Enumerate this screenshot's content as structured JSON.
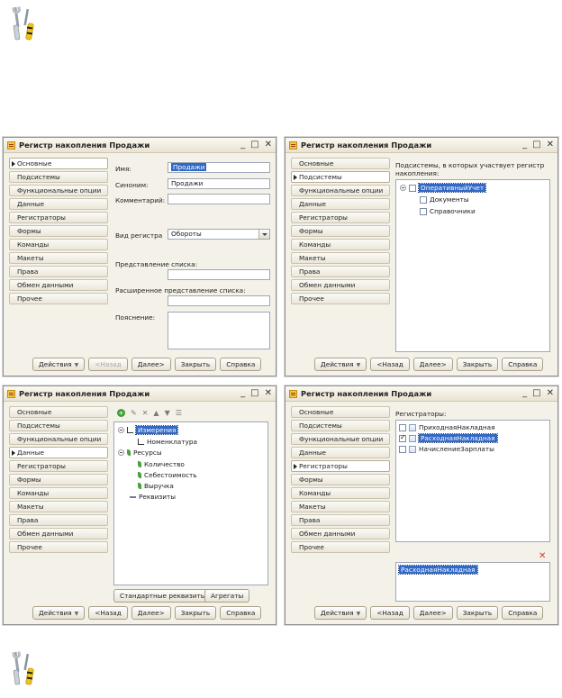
{
  "icons": {
    "top": "tools-icon",
    "bottom": "tools-icon"
  },
  "window_title": "Регистр накопления Продажи",
  "window_controls": [
    "_",
    "□",
    "✕"
  ],
  "nav_items": [
    "Основные",
    "Подсистемы",
    "Функциональные опции",
    "Данные",
    "Регистраторы",
    "Формы",
    "Команды",
    "Макеты",
    "Права",
    "Обмен данными",
    "Прочее"
  ],
  "buttons": {
    "actions": "Действия",
    "back": "<Назад",
    "next": "Далее>",
    "close": "Закрыть",
    "help": "Справка"
  },
  "win1": {
    "active_index": 0,
    "labels": {
      "name": "Имя:",
      "synonym": "Синоним:",
      "comment": "Комментарий:",
      "register_kind": "Вид регистра",
      "list_presentation": "Представление списка:",
      "ext_list_presentation": "Расширенное представление списка:",
      "explanation": "Пояснение:"
    },
    "values": {
      "name": "Продажи",
      "synonym": "Продажи",
      "comment": "",
      "register_kind": "Обороты",
      "list_presentation": "",
      "ext_list_presentation": "",
      "explanation": ""
    }
  },
  "win2": {
    "active_index": 1,
    "caption": "Подсистемы, в которых участвует регистр накопления:",
    "tree": {
      "root": "ОперативныйУчет",
      "children": [
        "Документы",
        "Справочники"
      ]
    }
  },
  "win3": {
    "active_index": 3,
    "tree": {
      "dimensions": "Измерения",
      "dimension_items": [
        "Номенклатура"
      ],
      "resources": "Ресурсы",
      "resource_items": [
        "Количество",
        "Себестоимость",
        "Выручка"
      ],
      "attributes": "Реквизиты"
    },
    "standard_attrs_button": "Стандартные реквизиты",
    "aggregates_button": "Агрегаты"
  },
  "win4": {
    "active_index": 4,
    "caption": "Регистраторы:",
    "registrars": [
      {
        "label": "ПриходнаяНакладная",
        "checked": false,
        "selected": false
      },
      {
        "label": "РасходнаяНакладная",
        "checked": true,
        "selected": true
      },
      {
        "label": "НачислениеЗарплаты",
        "checked": false,
        "selected": false
      }
    ],
    "selected_list": [
      "РасходнаяНакладная"
    ]
  }
}
